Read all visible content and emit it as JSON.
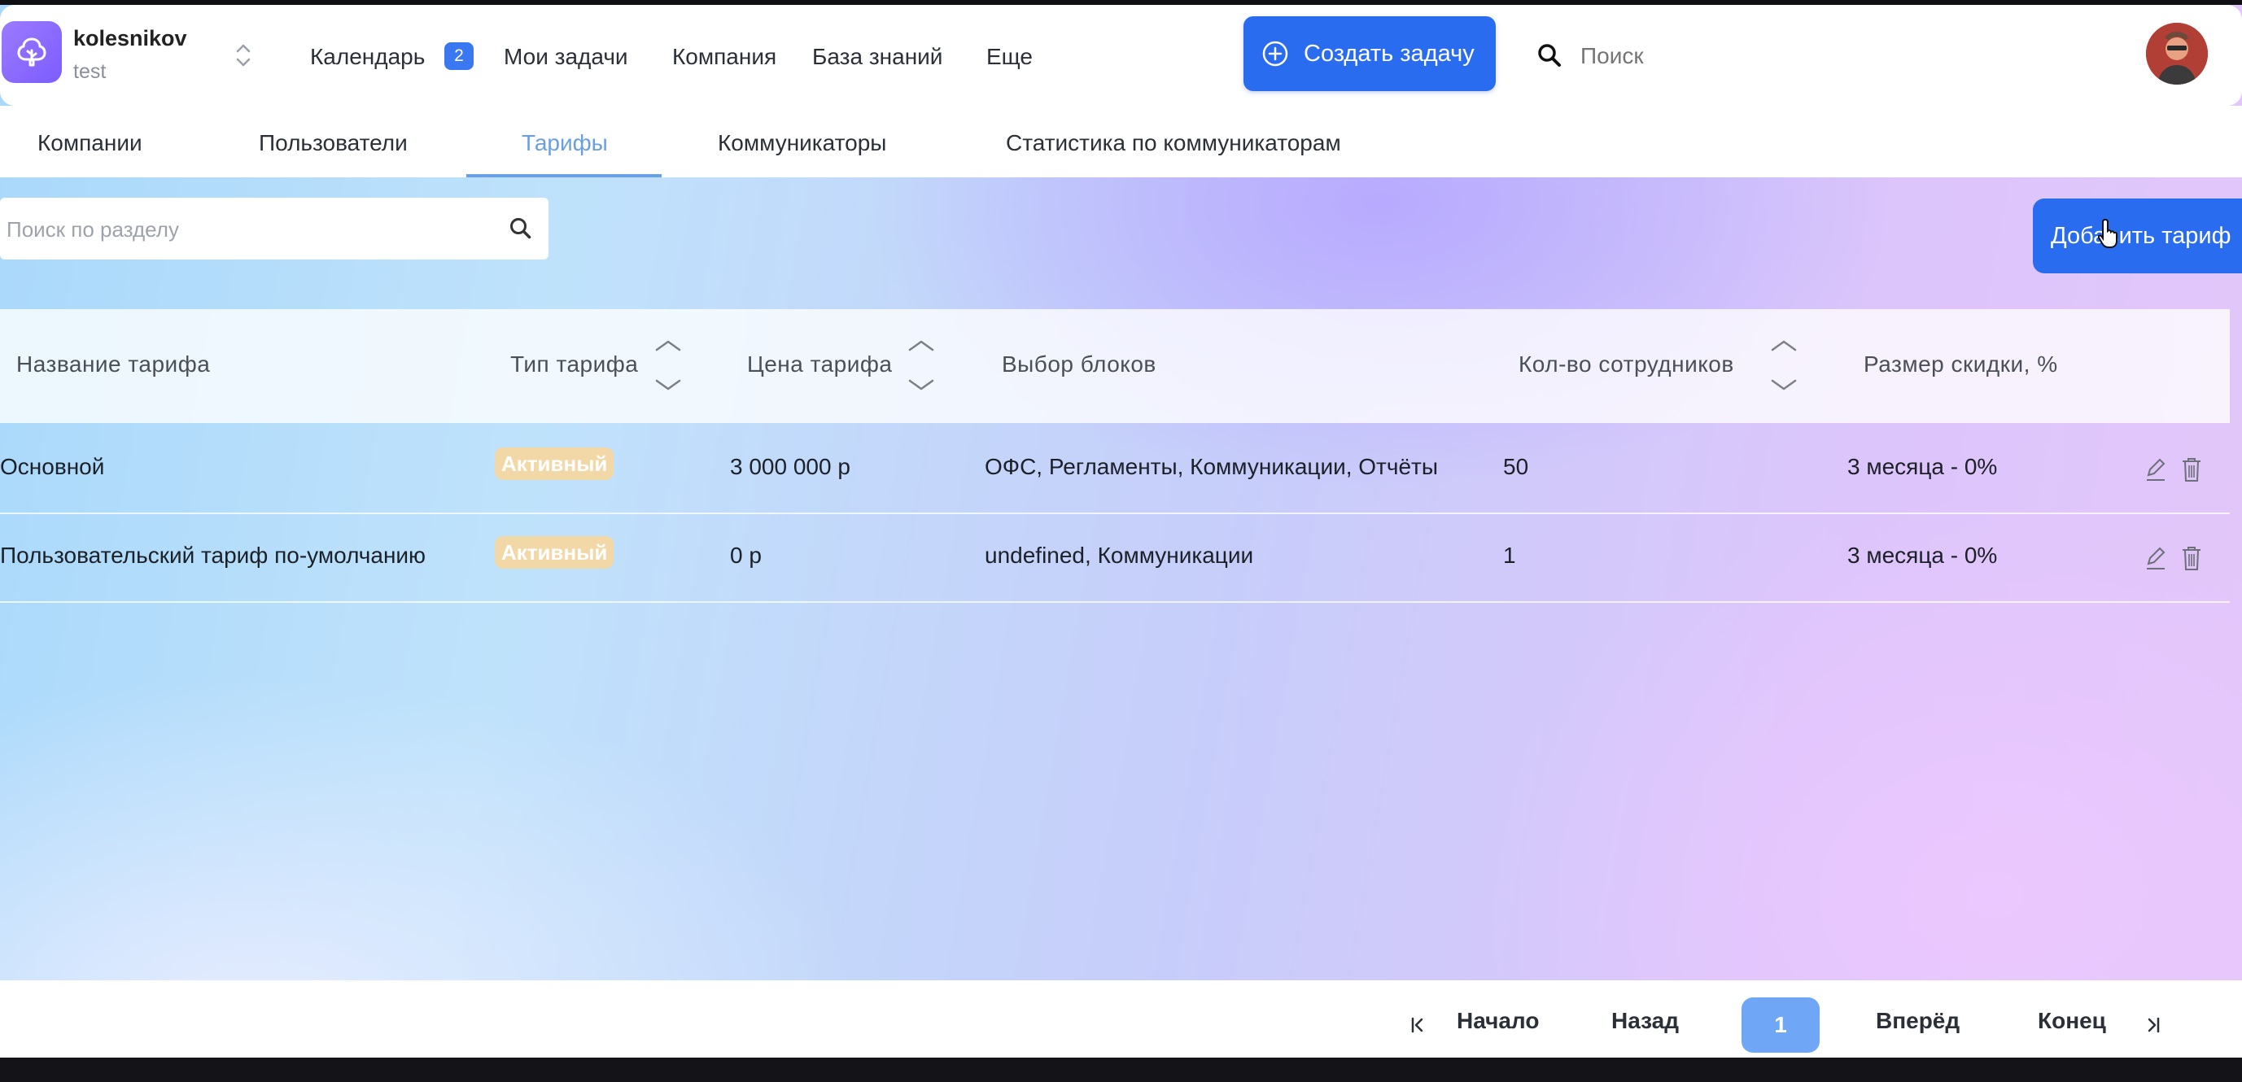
{
  "header": {
    "workspace_name": "kolesnikov",
    "workspace_sub": "test",
    "nav": [
      {
        "label": "Календарь",
        "badge": "2"
      },
      {
        "label": "Мои задачи"
      },
      {
        "label": "Компания"
      },
      {
        "label": "База знаний"
      },
      {
        "label": "Еще"
      }
    ],
    "create_task_label": "Создать задачу",
    "search_placeholder": "Поиск"
  },
  "tabs": [
    {
      "label": "Компании",
      "active": false
    },
    {
      "label": "Пользователи",
      "active": false
    },
    {
      "label": "Тарифы",
      "active": true
    },
    {
      "label": "Коммуникаторы",
      "active": false
    },
    {
      "label": "Статистика по коммуникаторам",
      "active": false
    }
  ],
  "toolbar": {
    "section_search_placeholder": "Поиск по разделу",
    "add_tariff_label": "Добавить тариф"
  },
  "table": {
    "columns": [
      {
        "label": "Название тарифа",
        "sortable": false
      },
      {
        "label": "Тип тарифа",
        "sortable": true
      },
      {
        "label": "Цена тарифа",
        "sortable": true
      },
      {
        "label": "Выбор блоков",
        "sortable": false
      },
      {
        "label": "Кол-во сотрудников",
        "sortable": true
      },
      {
        "label": "Размер скидки, %",
        "sortable": false
      }
    ],
    "rows": [
      {
        "name": "Основной",
        "type": "Активный",
        "price": "3 000 000 р",
        "blocks": "ОФС, Регламенты, Коммуникации, Отчёты",
        "employees": "50",
        "discount": "3 месяца - 0%"
      },
      {
        "name": "Пользовательский тариф по-умолчанию",
        "type": "Активный",
        "price": "0 р",
        "blocks": "undefined, Коммуникации",
        "employees": "1",
        "discount": "3 месяца - 0%"
      }
    ]
  },
  "pagination": {
    "first": "Начало",
    "prev": "Назад",
    "current": "1",
    "next": "Вперёд",
    "last": "Конец"
  },
  "colors": {
    "accent": "#2a6cf0",
    "active_tab": "#6a9fe0",
    "status_badge": "#f2d8a6"
  }
}
